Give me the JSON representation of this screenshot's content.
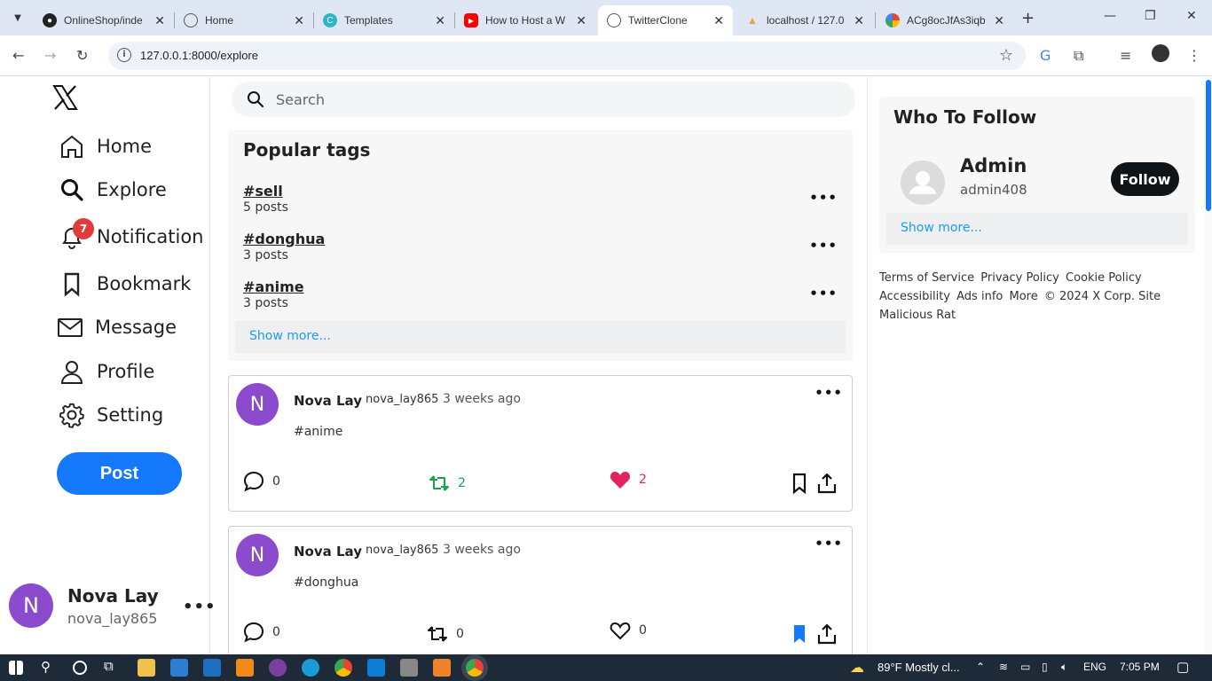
{
  "browser": {
    "tabs": [
      {
        "title": "OnlineShop/inde",
        "favicon": "github-icon",
        "active": false
      },
      {
        "title": "Home",
        "favicon": "globe-icon",
        "active": false
      },
      {
        "title": "Templates",
        "favicon": "canva-icon",
        "active": false
      },
      {
        "title": "How to Host a W",
        "favicon": "youtube-icon",
        "active": false
      },
      {
        "title": "TwitterClone",
        "favicon": "globe-icon",
        "active": true
      },
      {
        "title": "localhost / 127.0",
        "favicon": "phpmyadmin-icon",
        "active": false
      },
      {
        "title": "ACg8ocJfAs3iqb",
        "favicon": "google-photos-icon",
        "active": false
      }
    ],
    "url": "127.0.0.1:8000/explore"
  },
  "sidebar": {
    "items": [
      {
        "label": "Home",
        "icon": "home-icon"
      },
      {
        "label": "Explore",
        "icon": "search-icon"
      },
      {
        "label": "Notification",
        "icon": "bell-icon",
        "badge": "7"
      },
      {
        "label": "Bookmark",
        "icon": "bookmark-icon"
      },
      {
        "label": "Message",
        "icon": "mail-icon"
      },
      {
        "label": "Profile",
        "icon": "user-icon"
      },
      {
        "label": "Setting",
        "icon": "gear-icon"
      }
    ],
    "post_label": "Post",
    "current_user": {
      "avatar_letter": "N",
      "name": "Nova Lay",
      "handle": "nova_lay865"
    }
  },
  "search": {
    "placeholder": "Search"
  },
  "popular_tags": {
    "title": "Popular tags",
    "tags": [
      {
        "name": "#sell",
        "count": "5 posts"
      },
      {
        "name": "#donghua",
        "count": "3 posts"
      },
      {
        "name": "#anime",
        "count": "3 posts"
      }
    ],
    "show_more": "Show more..."
  },
  "posts": [
    {
      "avatar_letter": "N",
      "name": "Nova Lay",
      "handle": "nova_lay865",
      "time": "3 weeks ago",
      "text": "#anime",
      "comments": "0",
      "reposts": "2",
      "likes": "2",
      "reposted": true,
      "liked": true,
      "bookmarked": false
    },
    {
      "avatar_letter": "N",
      "name": "Nova Lay",
      "handle": "nova_lay865",
      "time": "3 weeks ago",
      "text": "#donghua",
      "comments": "0",
      "reposts": "0",
      "likes": "0",
      "reposted": false,
      "liked": false,
      "bookmarked": true
    }
  ],
  "who_to_follow": {
    "title": "Who To Follow",
    "user": {
      "name": "Admin",
      "handle": "admin408"
    },
    "follow_label": "Follow",
    "show_more": "Show more..."
  },
  "footer": {
    "links": [
      "Terms of Service",
      "Privacy Policy",
      "Cookie Policy",
      "Accessibility",
      "Ads info",
      "More"
    ],
    "copyright": "© 2024 X Corp. Site Malicious Rat"
  },
  "taskbar": {
    "weather": "89°F  Mostly cl...",
    "language": "ENG",
    "time": "7:05 PM"
  },
  "colors": {
    "accent": "#1479fb",
    "like": "#e0245e",
    "repost": "#17a349",
    "link": "#1d9bf0",
    "avatar": "#8b4bcc"
  }
}
